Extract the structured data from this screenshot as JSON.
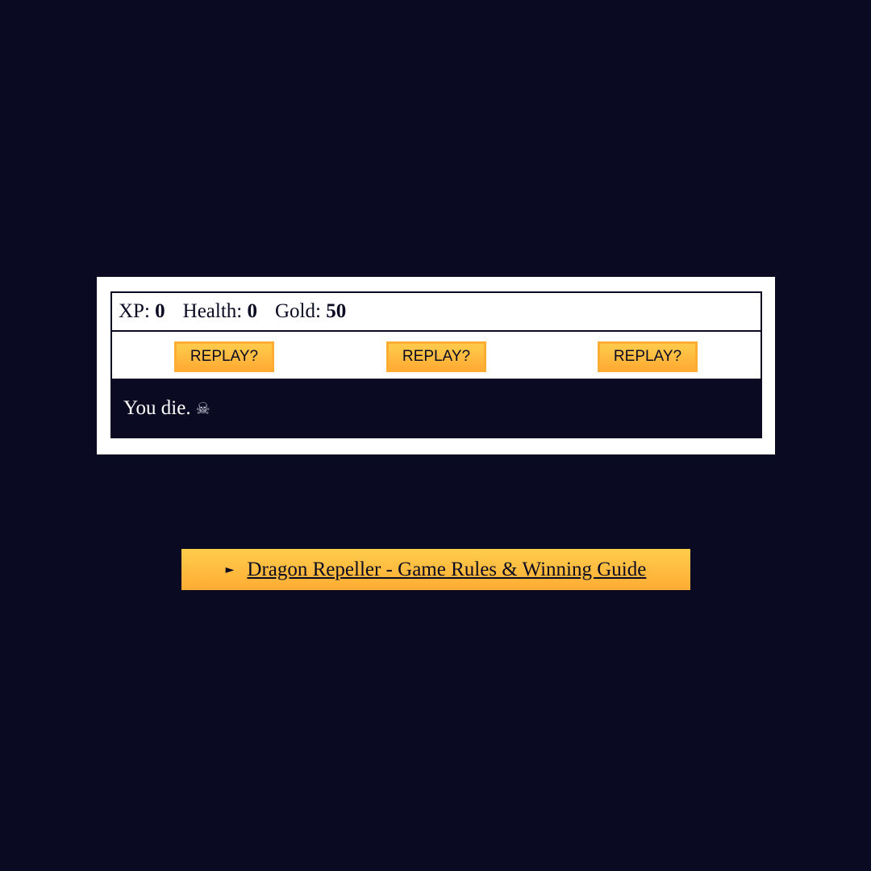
{
  "stats": {
    "xp_label": "XP:",
    "xp_value": "0",
    "health_label": "Health:",
    "health_value": "0",
    "gold_label": "Gold:",
    "gold_value": "50"
  },
  "controls": {
    "button1": "REPLAY?",
    "button2": "REPLAY?",
    "button3": "REPLAY?"
  },
  "message": {
    "text": "You die.",
    "icon": "☠"
  },
  "guide": {
    "arrow": "►",
    "label": "Dragon Repeller - Game Rules & Winning Guide"
  },
  "colors": {
    "background": "#0a0b23",
    "panel": "#ffffff",
    "button_top": "#fecc4c",
    "button_bottom": "#ffac33",
    "button_border": "#feac32"
  }
}
